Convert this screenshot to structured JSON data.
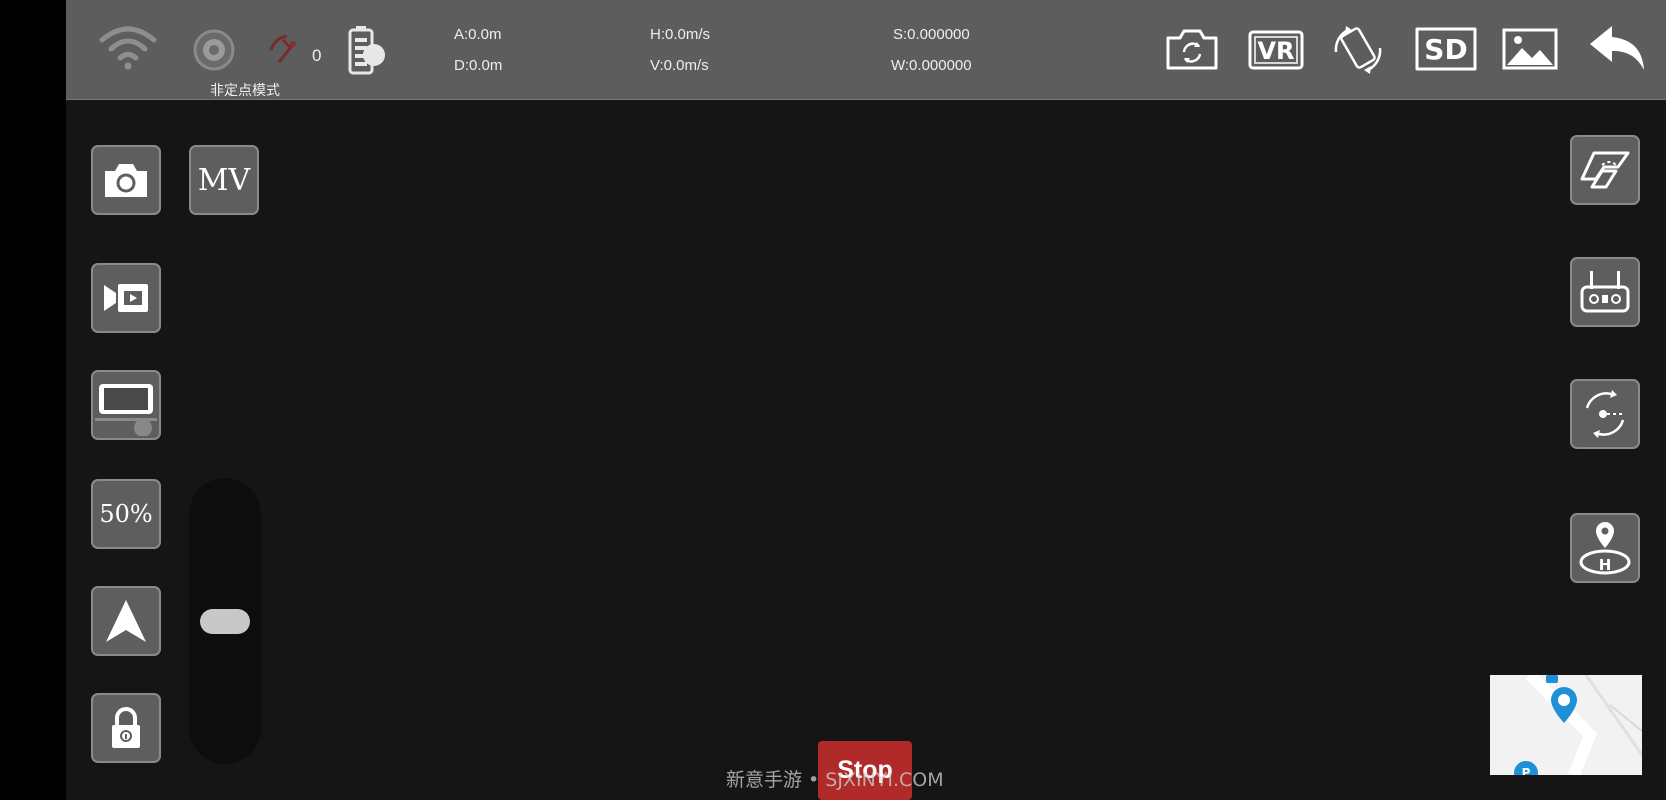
{
  "topbar": {
    "mode_label": "非定点模式",
    "satellite_count": "0",
    "telemetry": {
      "altitude": "A:0.0m",
      "distance": "D:0.0m",
      "h_speed": "H:0.0m/s",
      "v_speed": "V:0.0m/s",
      "s_coord": "S:0.000000",
      "w_coord": "W:0.000000"
    },
    "right_icons": [
      "camera-switch-icon",
      "vr-icon",
      "rotate-screen-icon",
      "sd-card-icon",
      "gallery-icon",
      "back-icon"
    ],
    "vr_label": "VR",
    "sd_label": "SD"
  },
  "left_panel": {
    "mv_label": "MV",
    "speed_label": "50%",
    "icons": [
      "camera-icon",
      "video-record-icon",
      "screen-layout-icon",
      "navigate-arrow-icon",
      "lock-icon"
    ]
  },
  "slider": {
    "level": 0.5
  },
  "right_panel": {
    "icons": [
      "flight-path-icon",
      "remote-controller-icon",
      "orbit-icon",
      "home-point-icon"
    ]
  },
  "bottom": {
    "stop_label": "Stop",
    "watermark": "新意手游 • SJXINYI.COM"
  },
  "colors": {
    "topbar": "#5d5d5d",
    "background": "#151515",
    "stop": "#b02a2a",
    "map_pin": "#1e90d6"
  }
}
